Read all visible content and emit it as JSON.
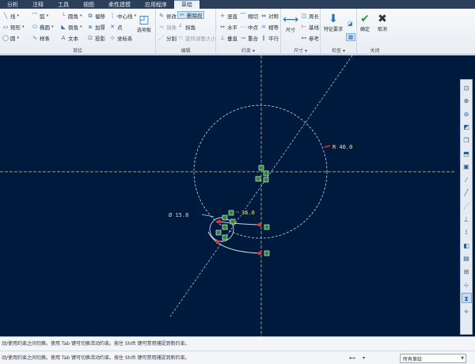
{
  "tabs": [
    "分析",
    "注释",
    "工具",
    "视图",
    "柔性建模",
    "应用程序",
    "草绘"
  ],
  "ribbon": {
    "sketch": {
      "label": "草绘",
      "line": "线",
      "arc": "弧",
      "fillet": "圆角",
      "offset": "偏移",
      "centerline": "中心线",
      "rect": "矩形",
      "ellipse": "椭圆",
      "chamfer": "倒角",
      "thicken": "加厚",
      "point": "点",
      "circle": "圆",
      "spline": "样条",
      "text": "文本",
      "project": "投影",
      "coordsys": "坐标系",
      "palette": "选项板"
    },
    "edit": {
      "label": "编辑",
      "modify": "修改",
      "delete_seg": "删除段",
      "mirror": "镜像",
      "corner": "拐角",
      "divide": "分割",
      "rotate_resize": "旋转调整大小"
    },
    "constrain": {
      "label": "约束 ▾",
      "vertical": "竖直",
      "tangent": "相切",
      "symmetric": "对称",
      "horizontal": "水平",
      "midpoint": "中点",
      "equal": "相等",
      "perpendicular": "垂直",
      "coincident": "重合",
      "parallel": "平行"
    },
    "dimension": {
      "label": "尺寸 ▾",
      "dim": "尺寸",
      "perimeter": "周长",
      "baseline": "基线",
      "reference": "参考"
    },
    "inspect": {
      "label": "检查 ▾",
      "feature_req": "特征要求"
    },
    "close": {
      "label": "关闭",
      "ok": "确定",
      "cancel": "取消"
    }
  },
  "canvas": {
    "dim_radius": "R 40.0",
    "dim_diameter": "Ø 15.8",
    "dim_value": "36.0"
  },
  "right_toolbar": [
    "zoom-fit",
    "zoom-in",
    "zoom-out",
    "repaint",
    "display-style",
    "saved-orientations",
    "datum-display",
    "plane-display",
    "axis-display",
    "point-display",
    "csys-display",
    "spin-center",
    "sketch-view",
    "dim-display",
    "constraint-display",
    "grid-display",
    "vertex-display",
    "select-active"
  ],
  "status": {
    "line1": "动/使用约束之间切换。使用 Tab 键可切换活动约束。按住 Shift 键可禁用捕捉到新约束。",
    "line2": "动/使用约束之间切换。使用 Tab 键可切换活动约束。按住 Shift 键可禁用捕捉到新约束。",
    "filter_value": "所有草绘"
  },
  "colors": {
    "canvas_bg": "#001a3d",
    "sketch": "#c8d4e4",
    "dimension": "#f0e68c",
    "axis": "#d8d080",
    "endpoint": "#e03030",
    "constraint": "#2a8a3a"
  }
}
